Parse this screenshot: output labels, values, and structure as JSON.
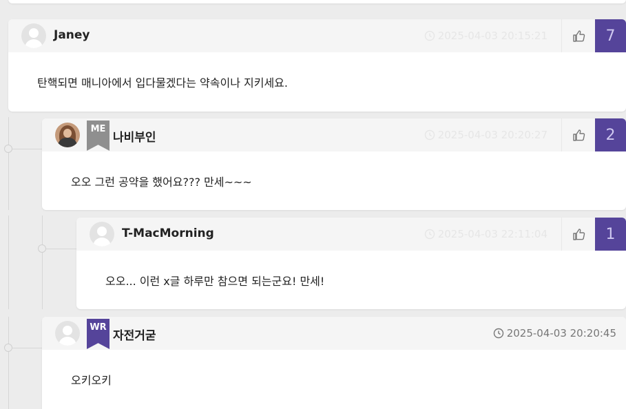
{
  "comments": [
    {
      "author": "Janey",
      "timestamp": "2025-04-03 20:15:21",
      "likes": "7",
      "body": "탄핵되면 매니아에서 입다물겠다는 약속이나 지키세요.",
      "avatar": "default-avatar"
    },
    {
      "author": "나비부인",
      "badge": "ME",
      "timestamp": "2025-04-03 20:20:27",
      "likes": "2",
      "body": "오오 그런 공약을 했어요??? 만세~~~",
      "avatar": "photo-avatar"
    },
    {
      "author": "T-MacMorning",
      "timestamp": "2025-04-03 22:11:04",
      "likes": "1",
      "body": "오오... 이런 x글 하루만 참으면 되는군요! 만세!",
      "avatar": "default-avatar"
    },
    {
      "author": "자전거굳",
      "badge": "WR",
      "timestamp": "2025-04-03 20:20:45",
      "body": "오키오키",
      "avatar": "default-avatar"
    }
  ],
  "icons": {
    "time": "clock-icon",
    "like": "thumbs-up-icon"
  },
  "colors": {
    "accent": "#55449a",
    "me_badge": "#8f8f8f",
    "background": "#ececec"
  }
}
